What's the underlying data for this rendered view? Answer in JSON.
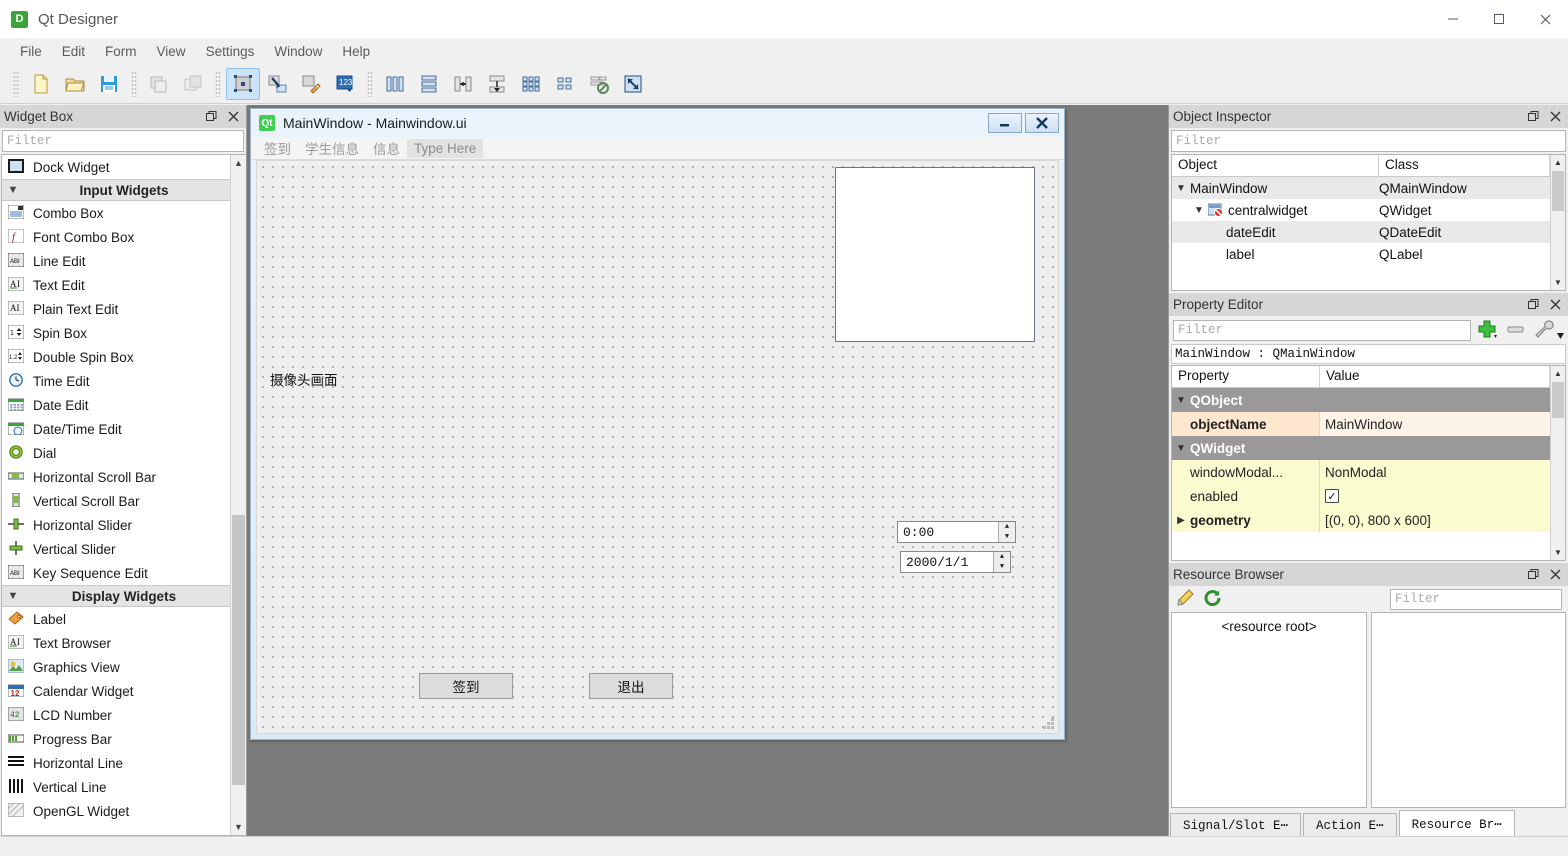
{
  "app": {
    "title": "Qt Designer",
    "icon": "designer-icon",
    "icon_letter": "D",
    "window_controls": [
      "minimize",
      "maximize",
      "close"
    ]
  },
  "menubar": {
    "items": [
      {
        "label": "File"
      },
      {
        "label": "Edit"
      },
      {
        "label": "Form"
      },
      {
        "label": "View"
      },
      {
        "label": "Settings"
      },
      {
        "label": "Window"
      },
      {
        "label": "Help"
      }
    ]
  },
  "toolbar": {
    "groups": [
      {
        "buttons": [
          {
            "name": "new-form-button",
            "icon": "new-file-icon",
            "active": false
          },
          {
            "name": "open-form-button",
            "icon": "open-folder-icon",
            "active": false
          },
          {
            "name": "save-form-button",
            "icon": "floppy-save-icon",
            "active": false
          }
        ]
      },
      {
        "buttons": [
          {
            "name": "undo-button",
            "icon": "undo-copy-icon",
            "active": false
          },
          {
            "name": "redo-button",
            "icon": "redo-copy-icon",
            "active": false
          }
        ]
      },
      {
        "buttons": [
          {
            "name": "edit-widgets-button",
            "icon": "edit-widgets-icon",
            "active": true
          },
          {
            "name": "edit-signals-slots-button",
            "icon": "signals-slots-icon",
            "active": false
          },
          {
            "name": "edit-buddies-button",
            "icon": "edit-buddies-icon",
            "active": false
          },
          {
            "name": "edit-tab-order-button",
            "icon": "tab-order-icon",
            "active": false
          }
        ]
      },
      {
        "buttons": [
          {
            "name": "layout-horizontally-button",
            "icon": "layout-horizontal-icon",
            "active": false
          },
          {
            "name": "layout-vertically-button",
            "icon": "layout-vertical-icon",
            "active": false
          },
          {
            "name": "layout-splitter-horizontal-button",
            "icon": "splitter-horizontal-icon",
            "active": false
          },
          {
            "name": "layout-splitter-vertical-button",
            "icon": "splitter-vertical-icon",
            "active": false
          },
          {
            "name": "layout-grid-button",
            "icon": "layout-grid-icon",
            "active": false
          },
          {
            "name": "layout-form-button",
            "icon": "layout-form-icon",
            "active": false
          },
          {
            "name": "break-layout-button",
            "icon": "break-layout-icon",
            "active": false
          },
          {
            "name": "adjust-size-button",
            "icon": "adjust-size-icon",
            "active": false
          }
        ]
      }
    ]
  },
  "widget_box": {
    "title": "Widget Box",
    "filter_placeholder": "Filter",
    "header_buttons": [
      "float-icon",
      "close-icon"
    ],
    "rows": [
      {
        "type": "item",
        "label": "Dock Widget",
        "icon": "dock-widget-icon"
      },
      {
        "type": "group",
        "label": "Input Widgets",
        "expanded": true
      },
      {
        "type": "item",
        "label": "Combo Box",
        "icon": "combo-box-icon"
      },
      {
        "type": "item",
        "label": "Font Combo Box",
        "icon": "font-combo-box-icon"
      },
      {
        "type": "item",
        "label": "Line Edit",
        "icon": "line-edit-icon"
      },
      {
        "type": "item",
        "label": "Text Edit",
        "icon": "text-edit-icon"
      },
      {
        "type": "item",
        "label": "Plain Text Edit",
        "icon": "plain-text-edit-icon"
      },
      {
        "type": "item",
        "label": "Spin Box",
        "icon": "spin-box-icon"
      },
      {
        "type": "item",
        "label": "Double Spin Box",
        "icon": "double-spin-box-icon"
      },
      {
        "type": "item",
        "label": "Time Edit",
        "icon": "time-edit-icon"
      },
      {
        "type": "item",
        "label": "Date Edit",
        "icon": "date-edit-icon"
      },
      {
        "type": "item",
        "label": "Date/Time Edit",
        "icon": "date-time-edit-icon"
      },
      {
        "type": "item",
        "label": "Dial",
        "icon": "dial-icon"
      },
      {
        "type": "item",
        "label": "Horizontal Scroll Bar",
        "icon": "horizontal-scroll-bar-icon"
      },
      {
        "type": "item",
        "label": "Vertical Scroll Bar",
        "icon": "vertical-scroll-bar-icon"
      },
      {
        "type": "item",
        "label": "Horizontal Slider",
        "icon": "horizontal-slider-icon"
      },
      {
        "type": "item",
        "label": "Vertical Slider",
        "icon": "vertical-slider-icon"
      },
      {
        "type": "item",
        "label": "Key Sequence Edit",
        "icon": "key-sequence-edit-icon"
      },
      {
        "type": "group",
        "label": "Display Widgets",
        "expanded": true
      },
      {
        "type": "item",
        "label": "Label",
        "icon": "label-icon"
      },
      {
        "type": "item",
        "label": "Text Browser",
        "icon": "text-browser-icon"
      },
      {
        "type": "item",
        "label": "Graphics View",
        "icon": "graphics-view-icon"
      },
      {
        "type": "item",
        "label": "Calendar Widget",
        "icon": "calendar-widget-icon"
      },
      {
        "type": "item",
        "label": "LCD Number",
        "icon": "lcd-number-icon"
      },
      {
        "type": "item",
        "label": "Progress Bar",
        "icon": "progress-bar-icon"
      },
      {
        "type": "item",
        "label": "Horizontal Line",
        "icon": "horizontal-line-icon"
      },
      {
        "type": "item",
        "label": "Vertical Line",
        "icon": "vertical-line-icon"
      },
      {
        "type": "item",
        "label": "OpenGL Widget",
        "icon": "opengl-widget-icon"
      }
    ]
  },
  "form_window": {
    "title": "MainWindow - Mainwindow.ui",
    "icon": "qt-icon",
    "icon_letter": "Qt",
    "buttons": [
      {
        "name": "form-minimize-button",
        "icon": "minimize-icon"
      },
      {
        "name": "form-close-button",
        "icon": "close-icon"
      }
    ],
    "menu": [
      {
        "label": "签到"
      },
      {
        "label": "学生信息"
      },
      {
        "label": "信息"
      },
      {
        "label": "Type Here",
        "placeholder": true
      }
    ],
    "widgets": {
      "camera_label": "摄像头画面",
      "time_edit_value": "0:00",
      "date_edit_value": "2000/1/1",
      "sign_in_button": "签到",
      "exit_button": "退出"
    }
  },
  "object_inspector": {
    "title": "Object Inspector",
    "filter_placeholder": "Filter",
    "columns": [
      "Object",
      "Class"
    ],
    "rows": [
      {
        "object": "MainWindow",
        "class": "QMainWindow",
        "indent": 0,
        "chevron": "down",
        "icon": null
      },
      {
        "object": "centralwidget",
        "class": "QWidget",
        "indent": 1,
        "chevron": "down",
        "icon": "central-widget-icon"
      },
      {
        "object": "dateEdit",
        "class": "QDateEdit",
        "indent": 2,
        "chevron": null,
        "icon": null
      },
      {
        "object": "label",
        "class": "QLabel",
        "indent": 2,
        "chevron": null,
        "icon": null
      }
    ]
  },
  "property_editor": {
    "title": "Property Editor",
    "filter_placeholder": "Filter",
    "context": "MainWindow : QMainWindow",
    "tool_buttons": [
      {
        "name": "add-dynamic-property-button",
        "icon": "plus-icon"
      },
      {
        "name": "remove-dynamic-property-button",
        "icon": "minus-icon"
      },
      {
        "name": "configure-property-editor-button",
        "icon": "wrench-icon"
      }
    ],
    "columns": [
      "Property",
      "Value"
    ],
    "rows": [
      {
        "kind": "group",
        "property": "QObject",
        "value": "",
        "chevron": "down"
      },
      {
        "kind": "objname",
        "property": "objectName",
        "value": "MainWindow",
        "chevron": null
      },
      {
        "kind": "group",
        "property": "QWidget",
        "value": "",
        "chevron": "down"
      },
      {
        "kind": "prop",
        "property": "windowModal...",
        "value": "NonModal",
        "chevron": null
      },
      {
        "kind": "checkbox",
        "property": "enabled",
        "value": "✓",
        "chevron": null
      },
      {
        "kind": "bold",
        "property": "geometry",
        "value": "[(0, 0), 800 x 600]",
        "chevron": "right"
      }
    ]
  },
  "resource_browser": {
    "title": "Resource Browser",
    "filter_placeholder": "Filter",
    "tool_buttons": [
      {
        "name": "edit-resources-button",
        "icon": "pencil-icon"
      },
      {
        "name": "reload-resources-button",
        "icon": "reload-icon"
      }
    ],
    "root_label": "<resource root>"
  },
  "bottom_tabs": [
    {
      "label": "Signal/Slot E⋯",
      "selected": false
    },
    {
      "label": "Action E⋯",
      "selected": false
    },
    {
      "label": "Resource Br⋯",
      "selected": true
    }
  ],
  "colors": {
    "accent": "#cce4f7",
    "canvas": "#7b7b7b",
    "form_title": "#dbe9f7",
    "prop_group": "#999999",
    "prop_yellow": "#fbfbd0",
    "prop_orange": "#fde7cf"
  }
}
